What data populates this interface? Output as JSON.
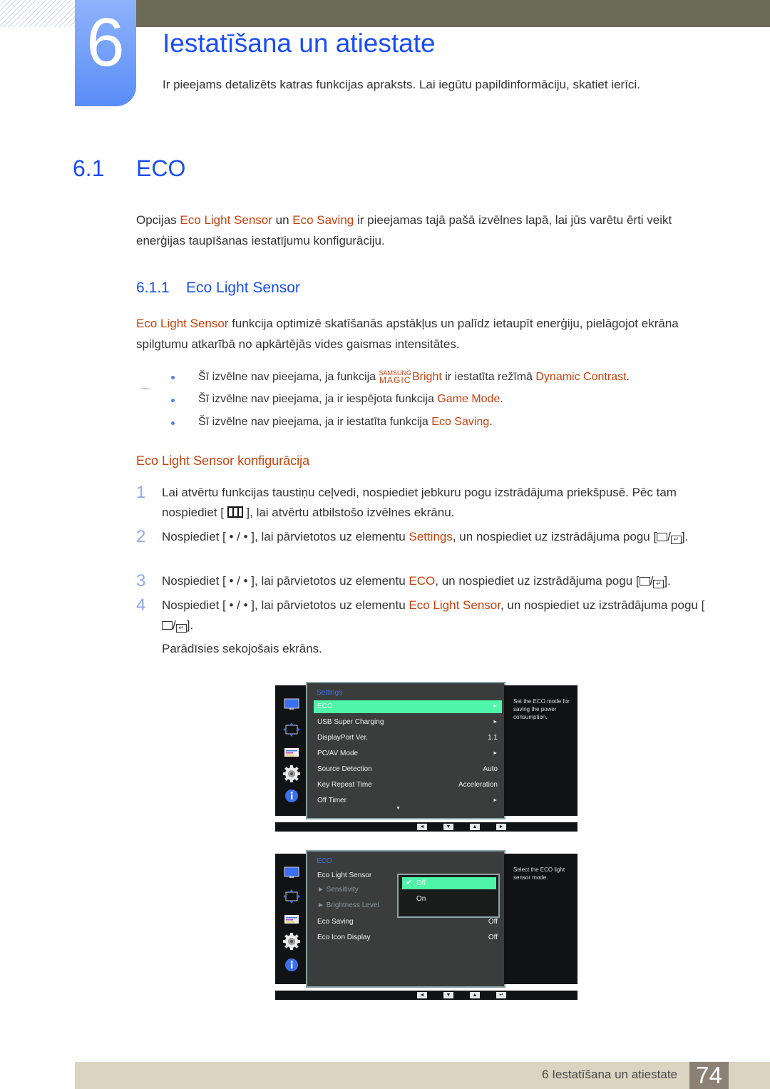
{
  "chapter": {
    "number": "6",
    "title": "Iestatīšana un atiestate",
    "intro": "Ir pieejams detalizēts katras funkcijas apraksts. Lai iegūtu papildinformāciju, skatiet ierīci."
  },
  "section": {
    "number": "6.1",
    "title": "ECO",
    "para": {
      "p1": "Opcijas ",
      "hl1": "Eco Light Sensor",
      "p2": " un ",
      "hl2": "Eco Saving",
      "p3": " ir pieejamas tajā pašā izvēlnes lapā, lai jūs varētu ērti veikt enerģijas taupīšanas iestatījumu konfigurāciju."
    }
  },
  "subsection": {
    "number": "6.1.1",
    "title": "Eco Light Sensor",
    "para": {
      "hl1": "Eco Light Sensor",
      "p1": " funkcija optimizē skatīšanās apstākļus un palīdz ietaupīt enerģiju, pielāgojot ekrāna spilgtumu atkarībā no apkārtējās vides gaismas intensitātes."
    }
  },
  "notes": [
    {
      "pre": "Šī izvēlne nav pieejama, ja funkcija ",
      "magic_top": "SAMSUNG",
      "magic_bottom": "MAGIC",
      "hl": "Bright",
      "mid": " ir iestatīta režīmā ",
      "hl2": "Dynamic Contrast",
      "post": "."
    },
    {
      "pre": "Šī izvēlne nav pieejama, ja ir iespējota funkcija ",
      "hl": "Game Mode",
      "post": "."
    },
    {
      "pre": "Šī izvēlne nav pieejama, ja ir iestatīta funkcija ",
      "hl": "Eco Saving",
      "post": "."
    }
  ],
  "config_heading": "Eco Light Sensor konfigurācija",
  "steps": [
    {
      "num": "1",
      "a": "Lai atvērtu funkcijas taustiņu ceļvedi, nospiediet jebkuru pogu izstrādājuma priekšpusē. Pēc tam nospiediet [ ",
      "b": " ], lai atvērtu atbilstošo izvēlnes ekrānu."
    },
    {
      "num": "2",
      "a": "Nospiediet [ • / • ], lai pārvietotos uz elementu ",
      "hl": "Settings",
      "b": ", un nospiediet uz izstrādājuma pogu [",
      "c": "]."
    },
    {
      "num": "3",
      "a": "Nospiediet [ • / • ], lai pārvietotos uz elementu ",
      "hl": "ECO",
      "b": ", un nospiediet uz izstrādājuma pogu [",
      "c": "]."
    },
    {
      "num": "4",
      "a": "Nospiediet [ • / • ], lai pārvietotos uz elementu ",
      "hl": "Eco Light Sensor",
      "b": ", un nospiediet uz izstrādājuma pogu [",
      "c": "]."
    }
  ],
  "result_text": "Parādīsies sekojošais ekrāns.",
  "osd1": {
    "heading": "Settings",
    "rows": [
      {
        "label": "ECO",
        "value": "►",
        "selected": true
      },
      {
        "label": "USB Super Charging",
        "value": "►"
      },
      {
        "label": "DisplayPort Ver.",
        "value": "1.1"
      },
      {
        "label": "PC/AV Mode",
        "value": "►"
      },
      {
        "label": "Source Detection",
        "value": "Auto"
      },
      {
        "label": "Key Repeat Time",
        "value": "Acceleration"
      },
      {
        "label": "Off Timer",
        "value": "►"
      }
    ],
    "more": "▼",
    "help": "Set the ECO mode for saving the power consumption.",
    "buttons": [
      "◄",
      "▼",
      "▲",
      "►"
    ]
  },
  "osd2": {
    "heading": "ECO",
    "rows": [
      {
        "label": "Eco Light Sensor",
        "value": ""
      },
      {
        "label": "► Sensitivity",
        "value": "",
        "dim": true
      },
      {
        "label": "► Brightness Level",
        "value": "",
        "dim": true
      },
      {
        "label": "Eco Saving",
        "value": "Off"
      },
      {
        "label": "Eco Icon Display",
        "value": "Off"
      }
    ],
    "options": [
      {
        "label": "Off",
        "selected": true,
        "check": "✔"
      },
      {
        "label": "On"
      }
    ],
    "help": "Select the ECO light sensor mode.",
    "buttons": [
      "◄",
      "▼",
      "▲",
      "↵"
    ]
  },
  "footer": {
    "text": "6 Iestatīšana un atiestate",
    "page": "74"
  }
}
